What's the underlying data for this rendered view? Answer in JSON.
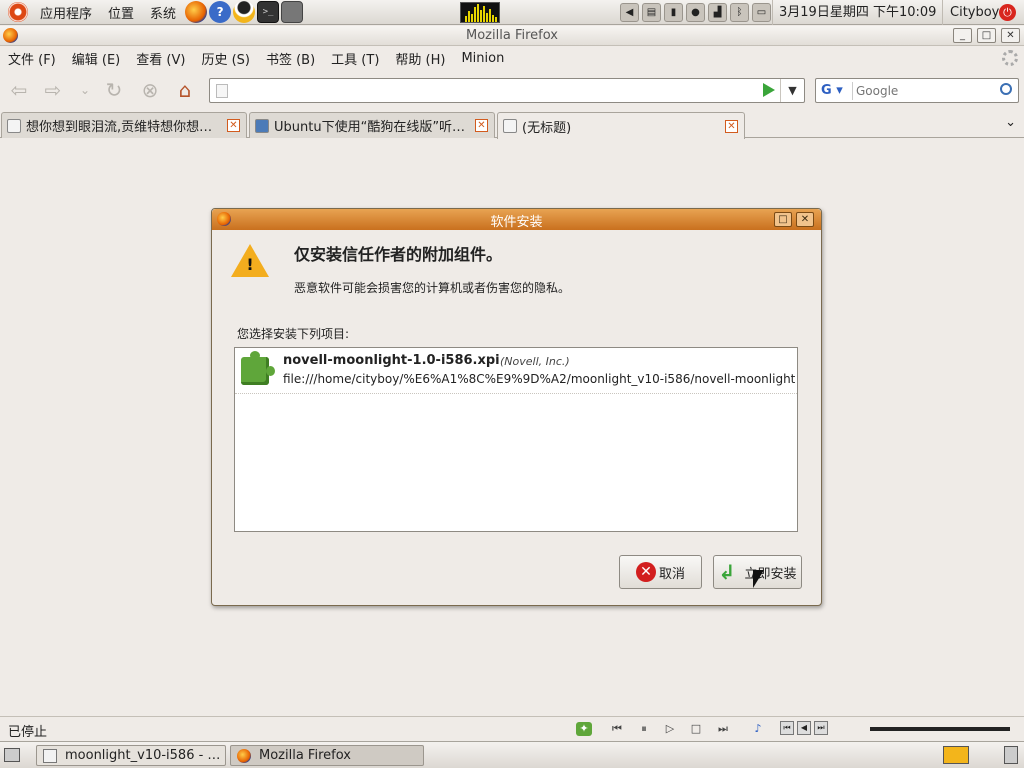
{
  "top_panel": {
    "menus": [
      "应用程序",
      "位置",
      "系统"
    ],
    "clock": "3月19日星期四 下午10:09",
    "user": "Cityboy"
  },
  "window": {
    "title": "Mozilla Firefox"
  },
  "menubar": {
    "items": [
      "文件 (F)",
      "编辑 (E)",
      "查看 (V)",
      "历史 (S)",
      "书签 (B)",
      "工具 (T)",
      "帮助 (H)",
      "Minion"
    ]
  },
  "navbar": {
    "url_value": "",
    "search_placeholder": "Google",
    "search_engine": "G"
  },
  "tabs": [
    {
      "label": "想你想到眼泪流,贡维特想你想…"
    },
    {
      "label": "Ubuntu下使用“酷狗在线版”听…"
    },
    {
      "label": "(无标题)",
      "active": true
    }
  ],
  "dialog": {
    "title": "软件安装",
    "heading": "仅安装信任作者的附加组件。",
    "warning": "恶意软件可能会损害您的计算机或者伤害您的隐私。",
    "list_label": "您选择安装下列项目:",
    "items": [
      {
        "name": "novell-moonlight-1.0-i586.xpi",
        "author": "(Novell, Inc.)",
        "url": "file:///home/cityboy/%E6%A1%8C%E9%9D%A2/moonlight_v10-i586/novell-moonlight-"
      }
    ],
    "cancel_label": "取消",
    "install_label": "立即安装"
  },
  "statusbar": {
    "text": "已停止"
  },
  "taskbar": {
    "items": [
      "moonlight_v10-i586 - …",
      "Mozilla Firefox"
    ]
  }
}
